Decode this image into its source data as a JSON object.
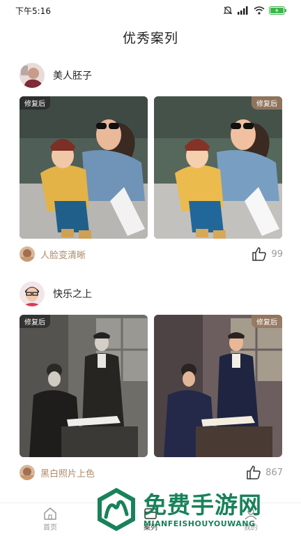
{
  "status_bar": {
    "time": "下午5:16",
    "battery_label": "电量"
  },
  "page": {
    "title": "优秀案列"
  },
  "cases": [
    {
      "user": "美人胚子",
      "before_tag": "修复后",
      "after_tag": "修复后",
      "effect": "人脸变清晰",
      "likes": "99"
    },
    {
      "user": "快乐之上",
      "before_tag": "修复后",
      "after_tag": "修复后",
      "effect": "黑白照片上色",
      "likes": "867"
    }
  ],
  "tabs": [
    {
      "label": "首页",
      "icon": "home-icon"
    },
    {
      "label": "案列",
      "icon": "cases-icon"
    },
    {
      "label": "我的",
      "icon": "profile-icon"
    }
  ],
  "watermark": {
    "cn": "免费手游网",
    "en": "MIANFEISHOUYOUWANG"
  },
  "colors": {
    "accent": "#b08a6a",
    "watermark": "#18825a",
    "tag_dark": "#2c2c2c"
  }
}
